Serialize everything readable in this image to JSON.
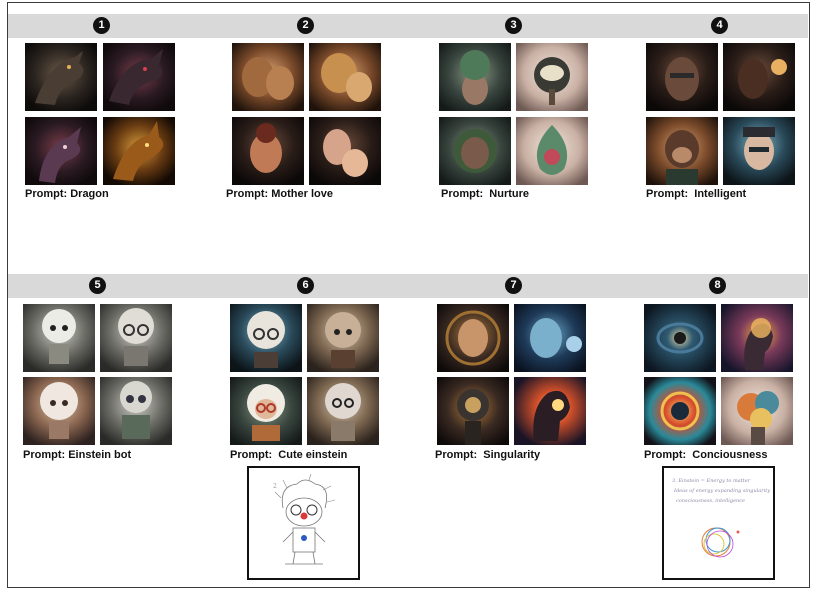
{
  "groups": [
    {
      "number": "1",
      "prompt": "Prompt: Dragon"
    },
    {
      "number": "2",
      "prompt": "Prompt: Mother love"
    },
    {
      "number": "3",
      "prompt": "Prompt:  Nurture"
    },
    {
      "number": "4",
      "prompt": "Prompt:  Intelligent"
    },
    {
      "number": "5",
      "prompt": "Prompt: Einstein bot"
    },
    {
      "number": "6",
      "prompt": "Prompt:  Cute einstein"
    },
    {
      "number": "7",
      "prompt": "Prompt:  Singularity"
    },
    {
      "number": "8",
      "prompt": "Prompt:  Conciousness"
    }
  ],
  "sketch_note": {
    "line1": "3. Einstein = Energy to matter",
    "line2": "Ideas of energy expanding singularity",
    "line3": "consciousness, intelligence"
  },
  "colors": {
    "band": "#d9d9d9",
    "badge": "#111111"
  }
}
